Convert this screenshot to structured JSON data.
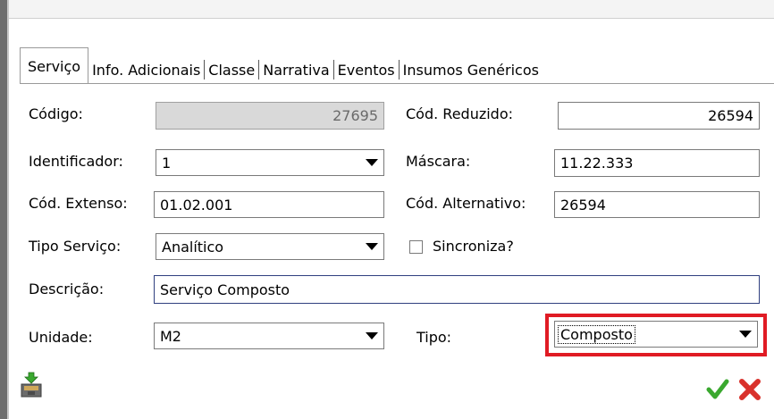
{
  "tabs": [
    {
      "label": "Serviço"
    },
    {
      "label": "Info. Adicionais"
    },
    {
      "label": "Classe"
    },
    {
      "label": "Narrativa"
    },
    {
      "label": "Eventos"
    },
    {
      "label": "Insumos Genéricos"
    }
  ],
  "form": {
    "codigo_label": "Código:",
    "codigo_value": "27695",
    "cod_reduzido_label": "Cód. Reduzido:",
    "cod_reduzido_value": "26594",
    "identificador_label": "Identificador:",
    "identificador_value": "1",
    "mascara_label": "Máscara:",
    "mascara_value": "11.22.333",
    "cod_extenso_label": "Cód. Extenso:",
    "cod_extenso_value": "01.02.001",
    "cod_alternativo_label": "Cód. Alternativo:",
    "cod_alternativo_value": "26594",
    "tipo_servico_label": "Tipo Serviço:",
    "tipo_servico_value": "Analítico",
    "sincroniza_label": "Sincroniza?",
    "sincroniza_checked": false,
    "descricao_label": "Descrição:",
    "descricao_value": "Serviço Composto",
    "unidade_label": "Unidade:",
    "unidade_value": "M2",
    "tipo_label": "Tipo:",
    "tipo_value": "Composto"
  },
  "colors": {
    "highlight": "#e01b24",
    "ok_green": "#3aa82f",
    "cancel_red": "#d9312b"
  },
  "icons": {
    "bottom_left": "save-to-archive-icon",
    "ok": "checkmark-icon",
    "cancel": "close-icon"
  }
}
